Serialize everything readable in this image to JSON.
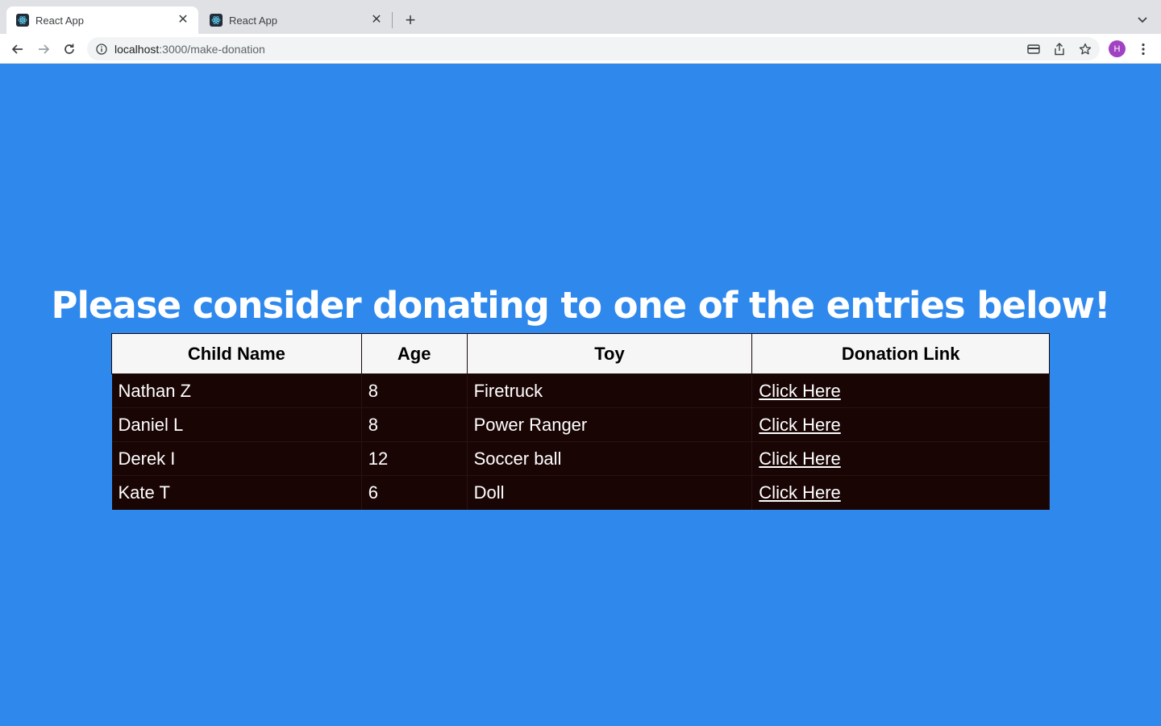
{
  "browser": {
    "tabs": [
      {
        "title": "React App",
        "active": true
      },
      {
        "title": "React App",
        "active": false
      }
    ],
    "url_host": "localhost",
    "url_path": ":3000/make-donation",
    "profile_initial": "H"
  },
  "page": {
    "heading": "Please consider donating to one of the entries below!",
    "background": "#2f89ed",
    "table": {
      "headers": [
        "Child Name",
        "Age",
        "Toy",
        "Donation Link"
      ],
      "rows": [
        {
          "name": "Nathan Z",
          "age": "8",
          "toy": "Firetruck",
          "link": "Click Here"
        },
        {
          "name": "Daniel L",
          "age": "8",
          "toy": "Power Ranger",
          "link": "Click Here"
        },
        {
          "name": "Derek I",
          "age": "12",
          "toy": "Soccer ball",
          "link": "Click Here"
        },
        {
          "name": "Kate T",
          "age": "6",
          "toy": "Doll",
          "link": "Click Here"
        }
      ]
    }
  }
}
